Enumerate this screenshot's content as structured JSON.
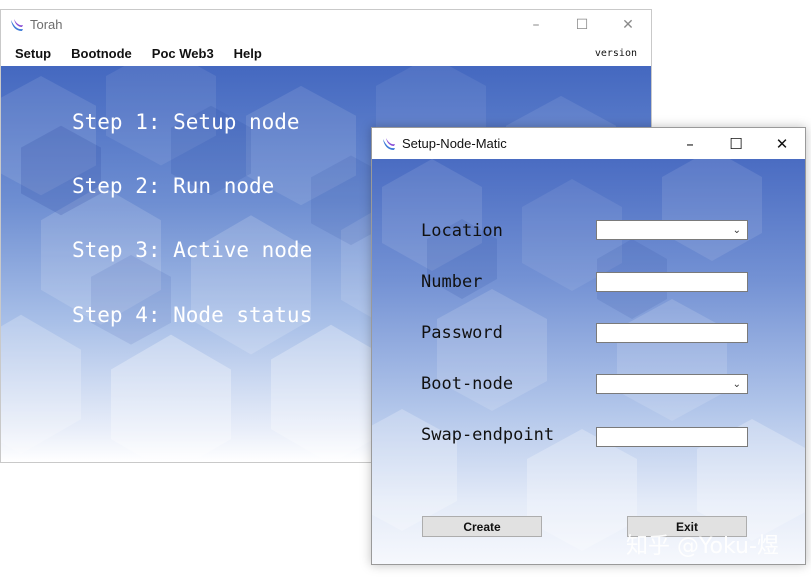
{
  "main_window": {
    "title": "Torah",
    "controls": {
      "minimize": "–",
      "maximize": "☐",
      "close": "✕"
    },
    "menu": [
      "Setup",
      "Bootnode",
      "Poc Web3",
      "Help"
    ],
    "version": "version",
    "steps": [
      "Step 1: Setup node",
      "Step 2: Run node",
      "Step 3: Active node",
      "Step 4: Node status"
    ]
  },
  "dialog": {
    "title": "Setup-Node-Matic",
    "controls": {
      "minimize": "–",
      "maximize": "☐",
      "close": "✕"
    },
    "fields": {
      "location": {
        "label": "Location",
        "value": ""
      },
      "number": {
        "label": "Number",
        "value": ""
      },
      "password": {
        "label": "Password",
        "value": ""
      },
      "boot_node": {
        "label": "Boot-node",
        "value": ""
      },
      "swap_endpoint": {
        "label": "Swap-endpoint",
        "value": ""
      }
    },
    "buttons": {
      "create": "Create",
      "exit": "Exit"
    }
  },
  "watermark": "知乎 @Yoku-煜",
  "colors": {
    "bg_dark_blue": "#4468c0",
    "bg_light": "#e9eef9",
    "app_icon_blue": "#3d7bd8",
    "app_icon_purple": "#8a4fd6"
  },
  "icons": {
    "app": "torah-logo-icon",
    "dropdown": "chevron-down-icon"
  }
}
